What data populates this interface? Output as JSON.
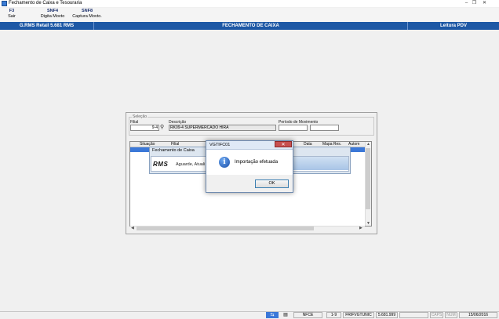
{
  "window": {
    "title": "Fechamento de Caixa e Tesouraria",
    "minimize": "–",
    "restore": "❐",
    "close": "✕"
  },
  "toolbar": [
    {
      "key": "F3",
      "label": "Sair"
    },
    {
      "key": "SNF4",
      "label": "Digita Movto"
    },
    {
      "key": "SNF8",
      "label": "Captura Movto."
    }
  ],
  "header": {
    "app": "G.RMS Retail 5.681 RMS",
    "screen": "FECHAMENTO DE CAIXA",
    "mode": "Leitura PDV"
  },
  "selection": {
    "legend": "Seleção",
    "filial_label": "Filial",
    "filial_value": "9-4",
    "descricao_label": "Descrição",
    "descricao_value": "RK09-4 SUPERMERCADO HIRA",
    "periodo_label": "Período de Movimento",
    "periodo_start": "",
    "periodo_end": ""
  },
  "grid": {
    "columns": [
      "Situação",
      "Filial",
      "Data",
      "Mapa Res.",
      "Autom"
    ]
  },
  "wait_window": {
    "title": "Fechamento de Caixa",
    "logo": "RMS",
    "message": "Aguarde, Atuali"
  },
  "message_box": {
    "title": "VGTIFC01",
    "icon": "info-icon",
    "text": "Importação efetuada",
    "ok_label": "OK"
  },
  "status": {
    "nfce": "NFCE",
    "page": "1-9",
    "program": "FRIFVGTUNIC",
    "version": "5.681.999",
    "caps": "CAPS",
    "num": "NUM",
    "date": "15/06/2016"
  },
  "colors": {
    "header_bar": "#1d58a5",
    "selection_row": "#3b78d8",
    "close_button": "#c75050"
  }
}
